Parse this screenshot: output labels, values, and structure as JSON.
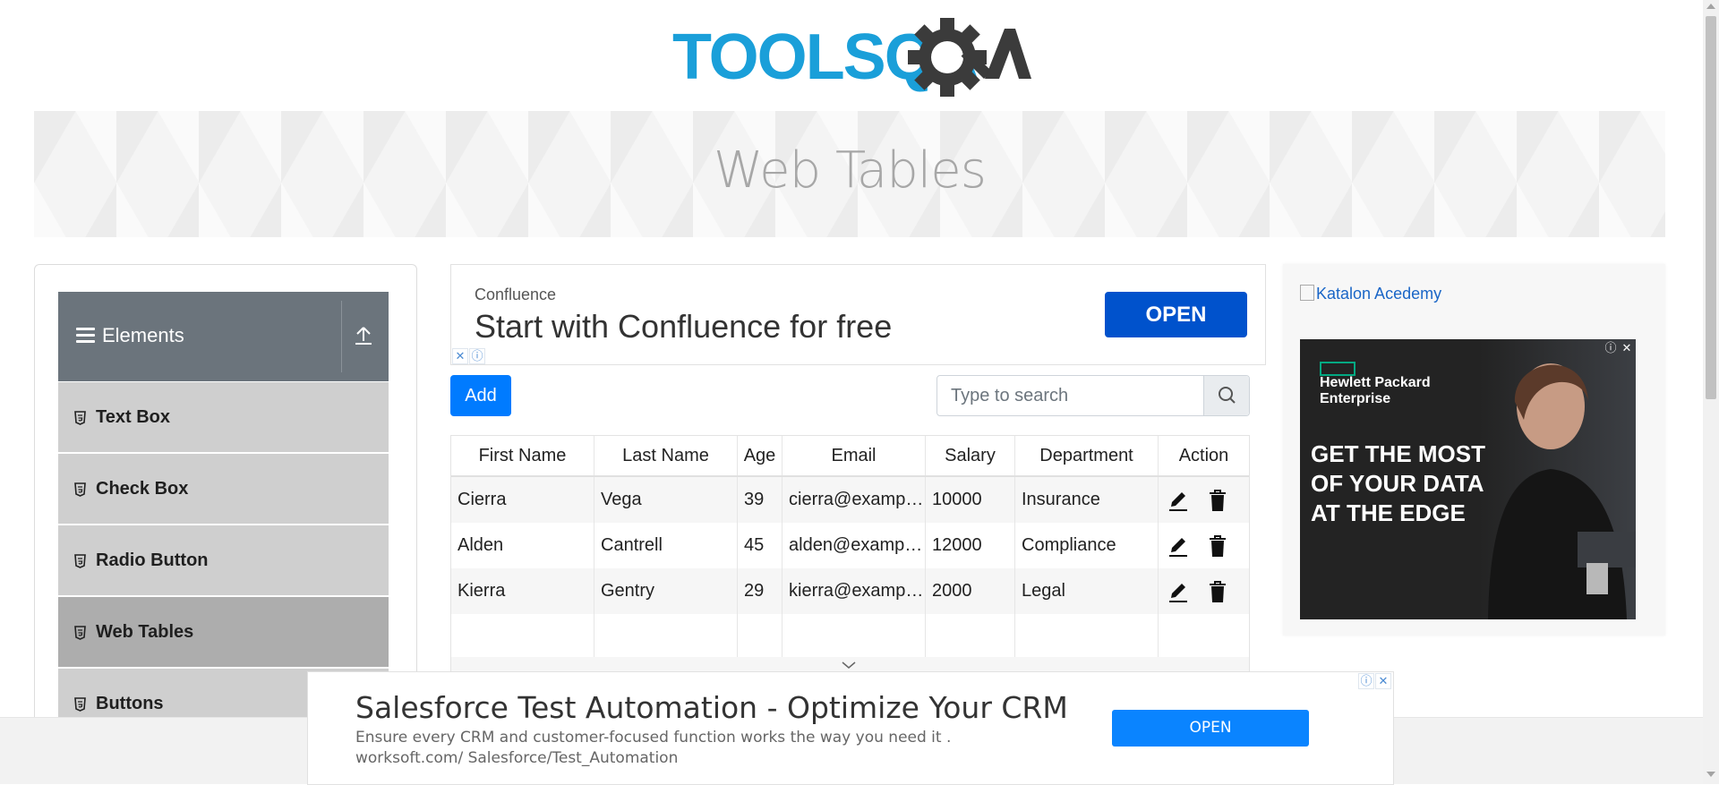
{
  "header": {
    "logo_text": "TOOLSQA",
    "page_title": "Web Tables"
  },
  "sidebar": {
    "group_title": "Elements",
    "items": [
      {
        "label": "Text Box"
      },
      {
        "label": "Check Box"
      },
      {
        "label": "Radio Button"
      },
      {
        "label": "Web Tables",
        "active": true
      },
      {
        "label": "Buttons"
      }
    ]
  },
  "top_ad": {
    "brand": "Confluence",
    "headline": "Start with Confluence for free",
    "button": "OPEN"
  },
  "toolbar": {
    "add_label": "Add",
    "search_placeholder": "Type to search"
  },
  "table": {
    "headers": [
      "First Name",
      "Last Name",
      "Age",
      "Email",
      "Salary",
      "Department",
      "Action"
    ],
    "rows": [
      [
        "Cierra",
        "Vega",
        "39",
        "cierra@example.com",
        "10000",
        "Insurance"
      ],
      [
        "Alden",
        "Cantrell",
        "45",
        "alden@example.com",
        "12000",
        "Compliance"
      ],
      [
        "Kierra",
        "Gentry",
        "29",
        "kierra@example.com",
        "2000",
        "Legal"
      ]
    ]
  },
  "right_ad": {
    "image_alt": "Katalon Acedemy",
    "brand": "Hewlett Packard Enterprise",
    "headline": "GET THE MOST OF YOUR DATA AT THE EDGE"
  },
  "bottom_ad": {
    "headline": "Salesforce Test Automation - Optimize Your CRM",
    "body": "Ensure every CRM and customer-focused function works the way you need it . worksoft.com/ Salesforce/Test_Automation",
    "button": "OPEN"
  },
  "colors": {
    "primary": "#007bff",
    "sidebar_header": "#6b747c",
    "menu_item": "#cfcfcf",
    "menu_item_active": "#adadad",
    "confluence_blue": "#0052cc",
    "logo_blue": "#1a9fd9",
    "logo_dark": "#3b3b3b"
  },
  "icons": {
    "menu": "hamburger-icon",
    "collapse": "upload-arrow-icon",
    "item": "html5-shield-icon",
    "search": "search-icon",
    "edit": "pencil-icon",
    "delete": "trash-icon",
    "ad_info": "info-icon",
    "ad_close": "close-icon"
  }
}
